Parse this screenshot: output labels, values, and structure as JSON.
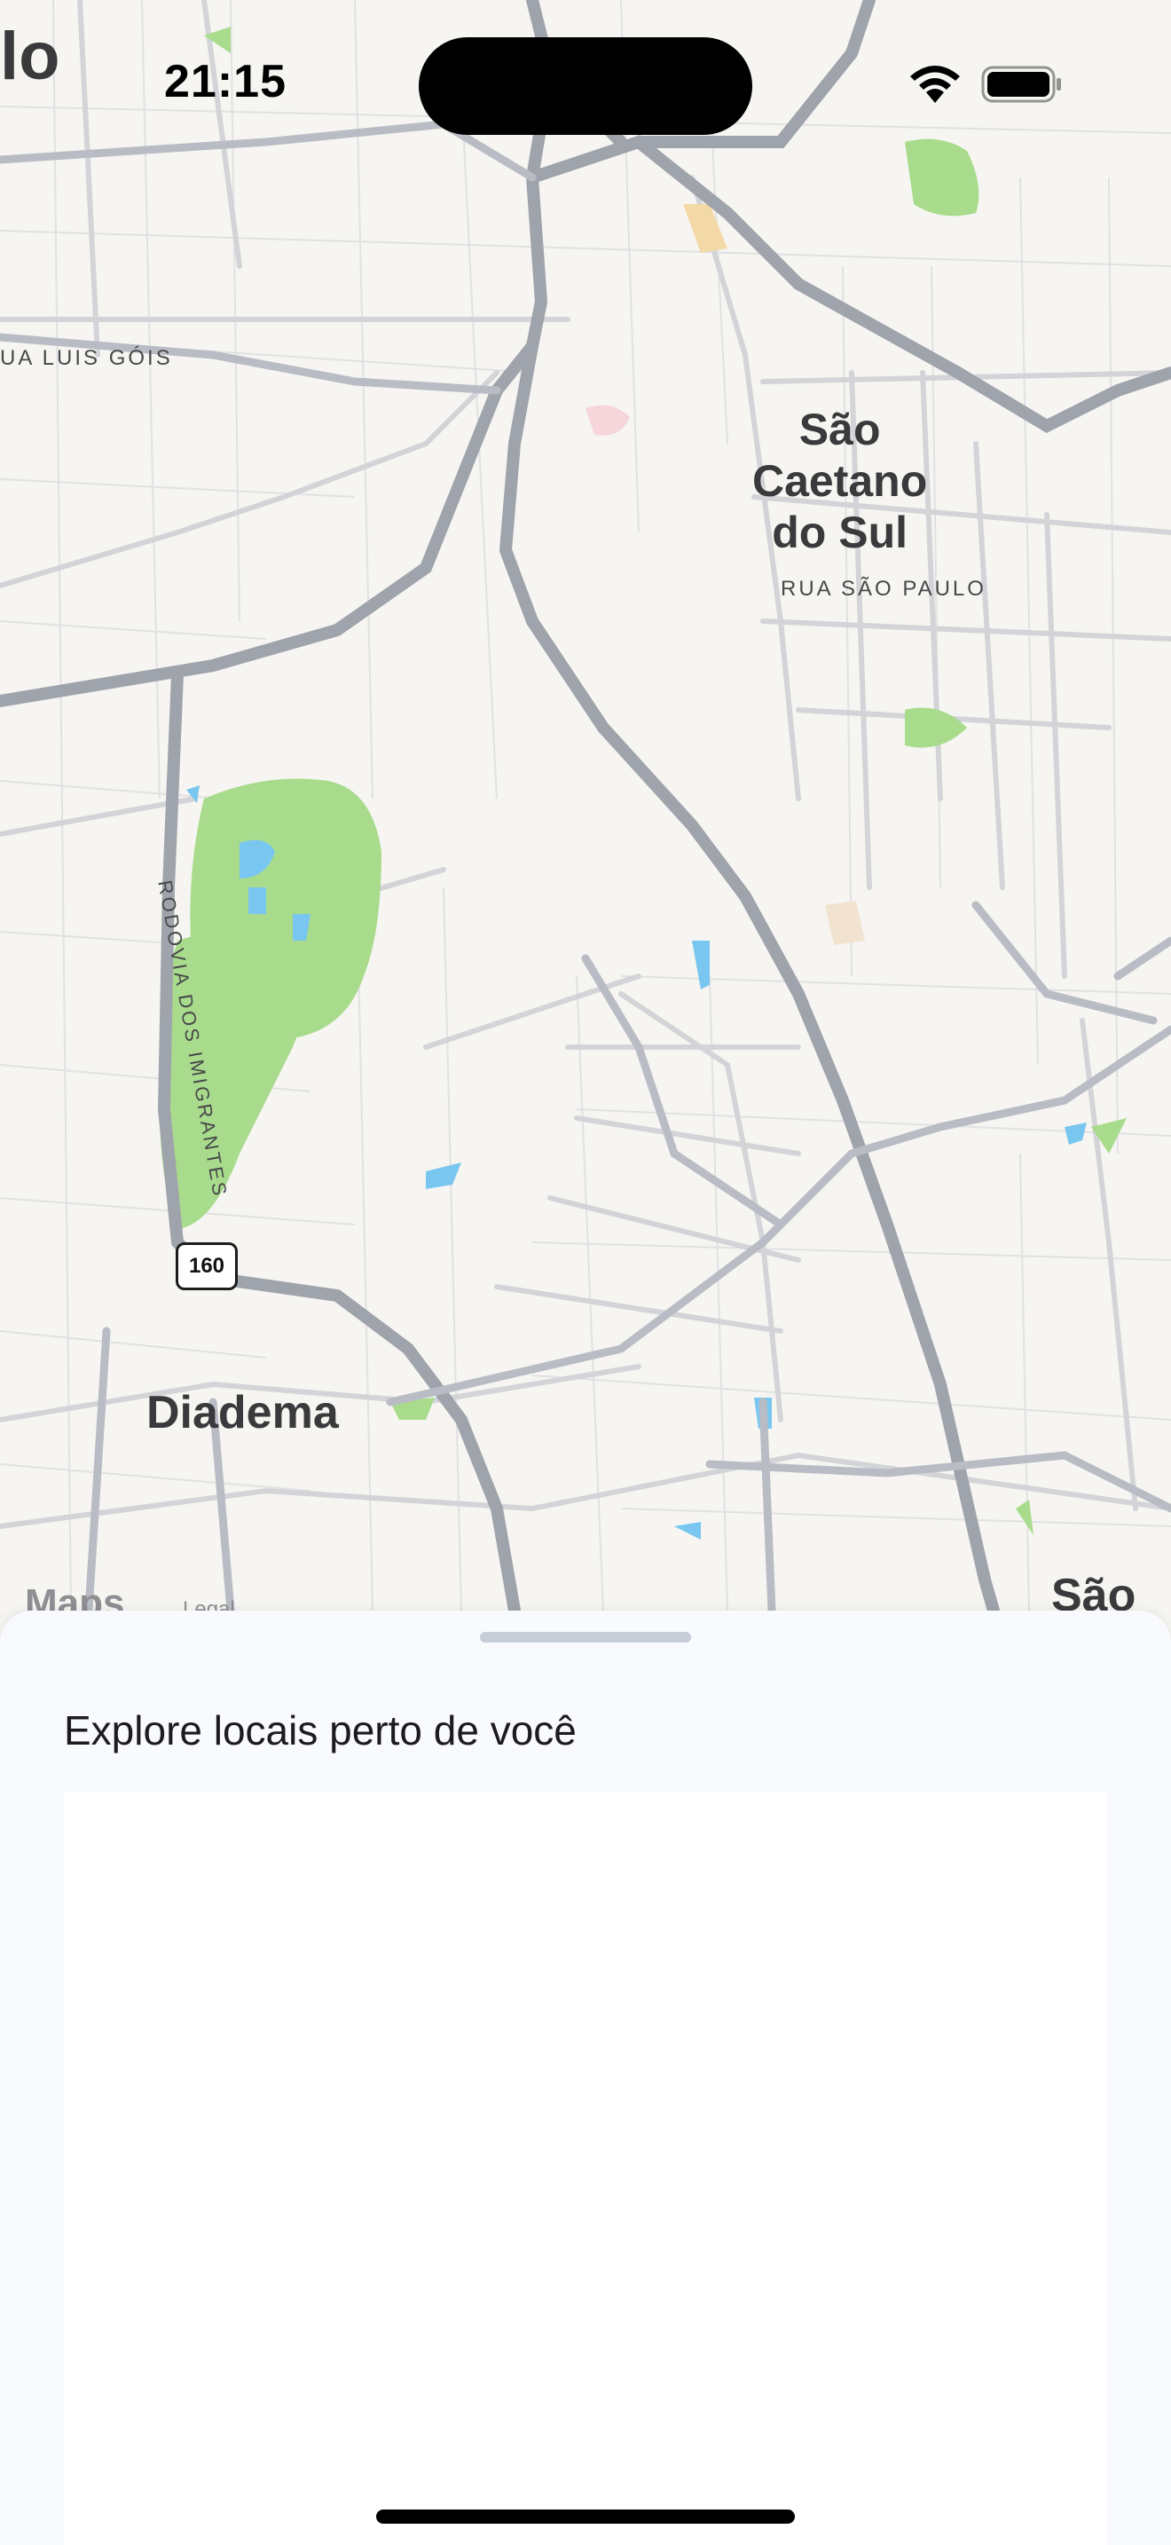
{
  "status_bar": {
    "time": "21:15"
  },
  "map": {
    "labels": {
      "city_top_left": "lo",
      "street_luis_gois": "UA LUIS GÓIS",
      "sao_caetano": "São\nCaetano\ndo Sul",
      "street_sao_paulo": "RUA SÃO PAULO",
      "rodovia": "RODOVIA DOS IMIGRANTES",
      "highway_shield": "160",
      "diadema": "Diadema",
      "sao_bottom_right": "São"
    },
    "attribution": {
      "logo": "Maps",
      "legal": "Legal"
    },
    "colors": {
      "park": "#a8dc8c",
      "water": "#79c6f0",
      "road": "#b9bcc4",
      "highway": "#9fa3ab",
      "land": "#f6f5f1"
    }
  },
  "sheet": {
    "title": "Explore locais perto de você"
  }
}
